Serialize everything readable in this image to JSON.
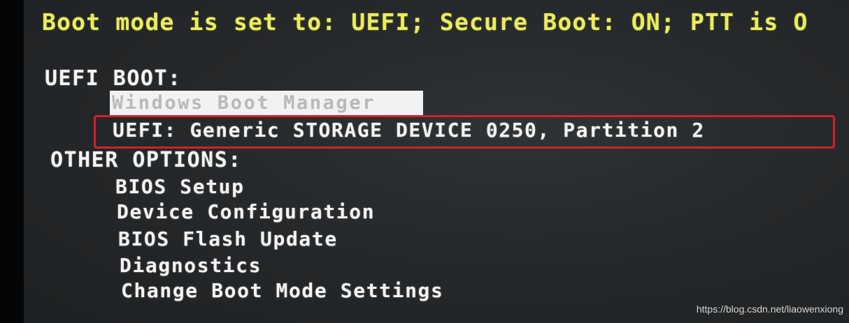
{
  "status_line": "Boot mode is set to: UEFI; Secure Boot: ON; PTT is O",
  "uefi_boot": {
    "heading": "UEFI BOOT:",
    "items": [
      {
        "label": "Windows Boot Manager",
        "selected": true
      },
      {
        "label": "UEFI: Generic STORAGE DEVICE 0250, Partition 2",
        "selected": false,
        "annotated": true
      }
    ]
  },
  "other_options": {
    "heading": "OTHER OPTIONS:",
    "items": [
      {
        "label": "BIOS Setup"
      },
      {
        "label": "Device Configuration"
      },
      {
        "label": "BIOS Flash Update"
      },
      {
        "label": "Diagnostics"
      },
      {
        "label": "Change Boot Mode Settings"
      }
    ]
  },
  "annotation": {
    "color": "#d4202a"
  },
  "watermark": "https://blog.csdn.net/liaowenxiong",
  "colors": {
    "status_text": "#ecec5c",
    "menu_text": "#f3f3f3",
    "selection_bg": "#f2f2f2",
    "screen_bg": "#2a2d2f"
  }
}
